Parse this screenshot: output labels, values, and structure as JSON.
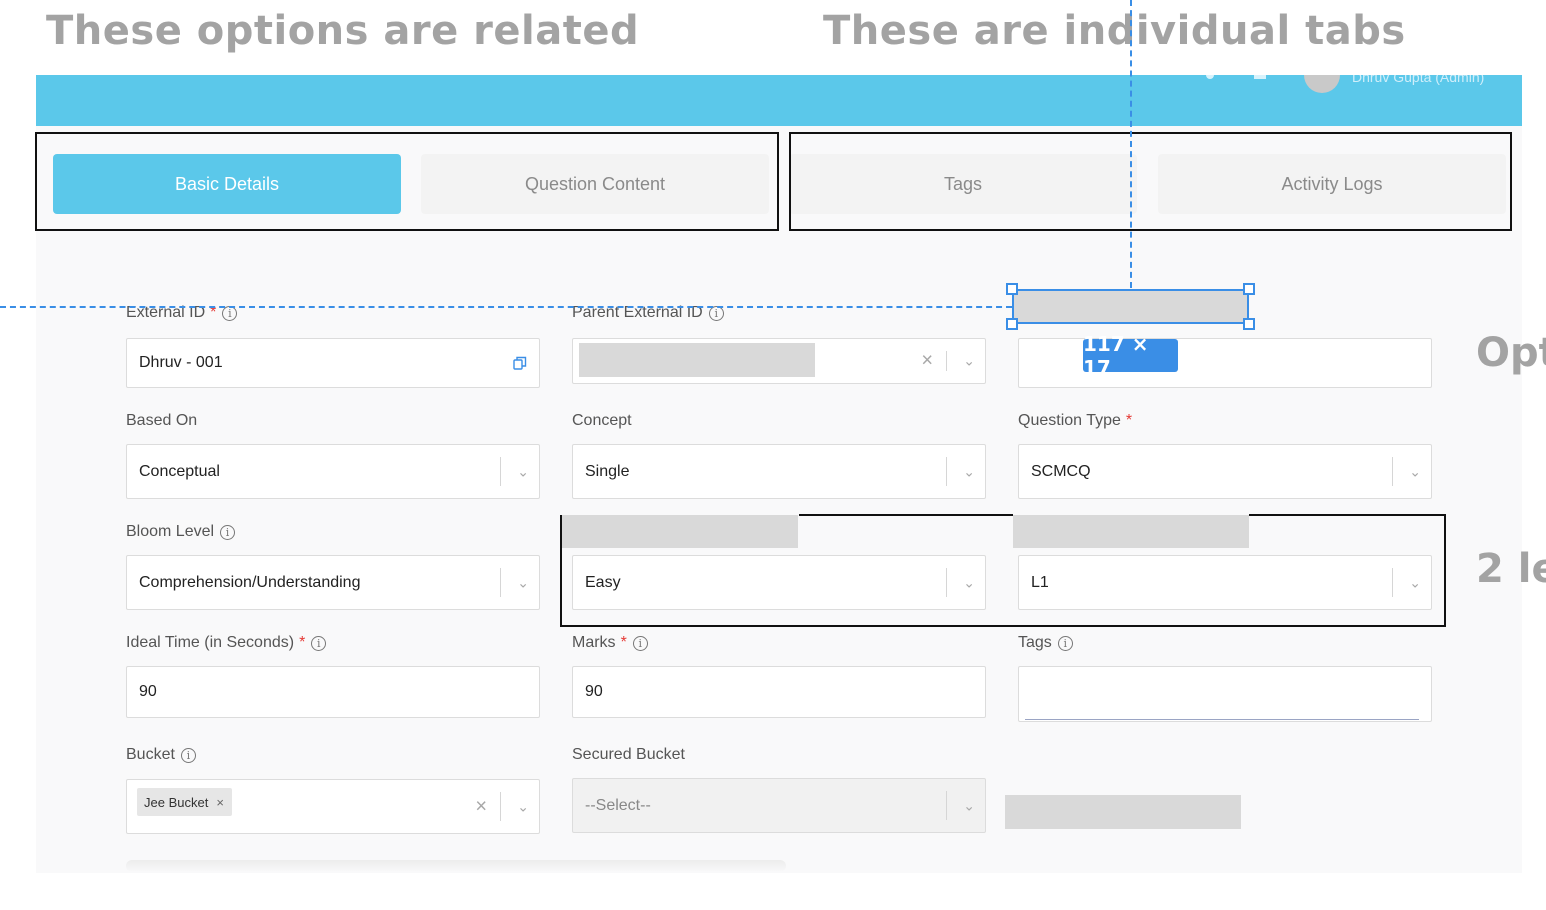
{
  "annotations": {
    "left_title": "These options are related",
    "right_title": "These are individual tabs",
    "side_1": "Opt",
    "side_2": "2 le",
    "dimension": "117 × 17"
  },
  "header": {
    "user": "Dhruv Gupta (Admin)"
  },
  "tabs": [
    {
      "label": "Basic Details",
      "active": true
    },
    {
      "label": "Question Content",
      "active": false
    },
    {
      "label": "Tags",
      "active": false
    },
    {
      "label": "Activity Logs",
      "active": false
    }
  ],
  "form": {
    "external_id": {
      "label": "External ID",
      "value": "Dhruv - 001"
    },
    "parent_external_id": {
      "label": "Parent External ID"
    },
    "based_on": {
      "label": "Based On",
      "value": "Conceptual"
    },
    "concept": {
      "label": "Concept",
      "value": "Single"
    },
    "question_type": {
      "label": "Question Type",
      "value": "SCMCQ"
    },
    "bloom_level": {
      "label": "Bloom Level",
      "value": "Comprehension/Understanding"
    },
    "difficulty": {
      "value": "Easy"
    },
    "level": {
      "value": "L1"
    },
    "ideal_time": {
      "label": "Ideal Time (in Seconds)",
      "value": "90"
    },
    "marks": {
      "label": "Marks",
      "value": "90"
    },
    "tags": {
      "label": "Tags",
      "value": ""
    },
    "bucket": {
      "label": "Bucket",
      "chip": "Jee Bucket"
    },
    "secured_bucket": {
      "label": "Secured Bucket",
      "placeholder": "--Select--"
    }
  },
  "icons": {
    "info": "i",
    "chevron": "⌄",
    "clear": "×",
    "chip_remove": "×",
    "required": "*"
  },
  "colors": {
    "accent": "#5bc8ea",
    "guide": "#3a8ee6",
    "required": "#e53935",
    "annotation": "#a3a3a3"
  }
}
